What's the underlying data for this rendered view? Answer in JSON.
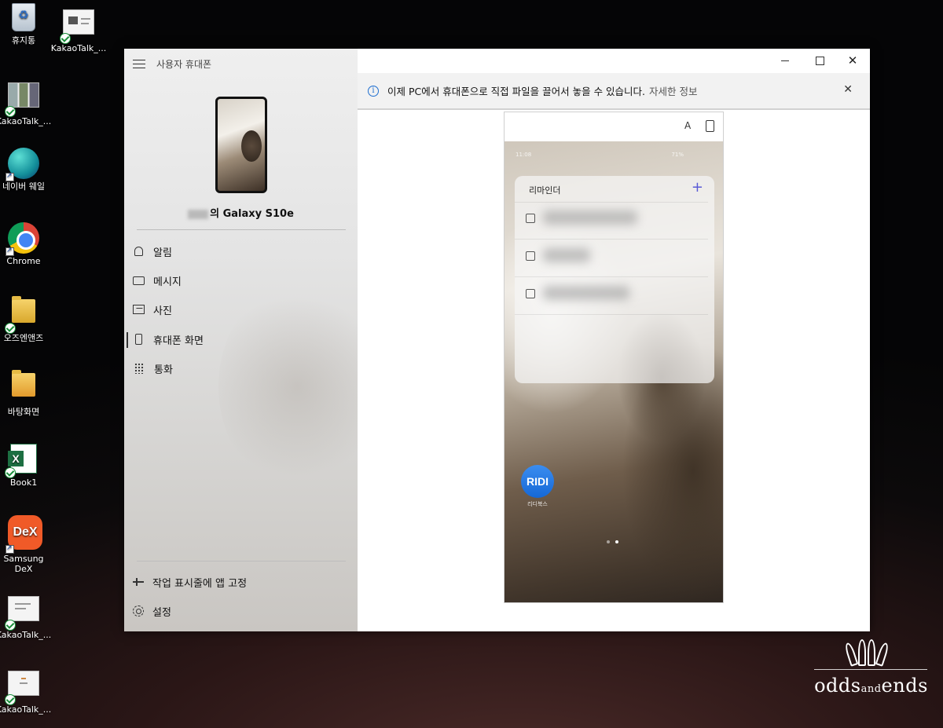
{
  "desktop": {
    "icons": [
      {
        "label": "휴지통"
      },
      {
        "label": "KakaoTalk_..."
      },
      {
        "label": "KakaoTalk_..."
      },
      {
        "label": "네이버 웨일"
      },
      {
        "label": "Chrome"
      },
      {
        "label": "오즈엔앤즈"
      },
      {
        "label": "바탕화면"
      },
      {
        "label": "Book1"
      },
      {
        "label": "Samsung DeX"
      },
      {
        "label": "KakaoTalk_..."
      },
      {
        "label": "KakaoTalk_..."
      }
    ],
    "dex_badge": "DeX"
  },
  "app": {
    "title": "사용자 휴대폰",
    "device_name": "의 Galaxy S10e",
    "nav": [
      {
        "label": "알림",
        "icon": "bell-icon"
      },
      {
        "label": "메시지",
        "icon": "message-icon"
      },
      {
        "label": "사진",
        "icon": "photo-icon"
      },
      {
        "label": "휴대폰 화면",
        "icon": "phone-screen-icon"
      },
      {
        "label": "통화",
        "icon": "dialpad-icon"
      }
    ],
    "footer": [
      {
        "label": "작업 표시줄에 앱 고정",
        "icon": "pin-icon"
      },
      {
        "label": "설정",
        "icon": "gear-icon"
      }
    ],
    "active_nav": "휴대폰 화면"
  },
  "window_controls": {
    "minimize": "",
    "maximize": "",
    "close": "✕"
  },
  "infobar": {
    "icon": "i",
    "message": "이제 PC에서 휴대폰으로 직접 파일을 끌어서 놓을 수 있습니다.",
    "link": "자세한 정보",
    "close": "✕"
  },
  "phone_screen": {
    "status_time": "11:08",
    "status_right": "71%",
    "widget_title": "리마인더",
    "widget_add": "+",
    "reminder_count": 3,
    "app_icon_label": "RIDI",
    "app_name": "리디북스",
    "page_dots": 2,
    "current_page": 2
  },
  "watermark": {
    "text_main": "odds",
    "text_mid": "and",
    "text_end": "ends"
  },
  "colors": {
    "accent": "#1f6fd0",
    "widget_add": "#5a5ad6",
    "ridi": "#1f78e6"
  }
}
